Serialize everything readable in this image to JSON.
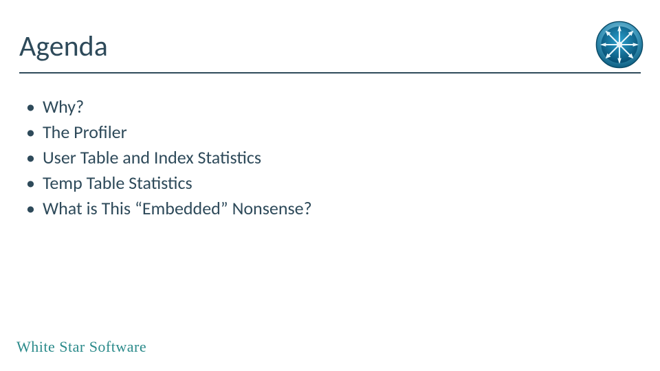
{
  "title": "Agenda",
  "bullets": [
    "Why?",
    "The Profiler",
    "User Table and Index Statistics",
    "Temp Table Statistics",
    "What is This “Embedded” Nonsense?"
  ],
  "footer": "White Star Software",
  "colors": {
    "text": "#2e4a5a",
    "accent": "#2a8a8a",
    "logo_inner": "#0b7aa3",
    "logo_ring": "#4aa0c0"
  }
}
